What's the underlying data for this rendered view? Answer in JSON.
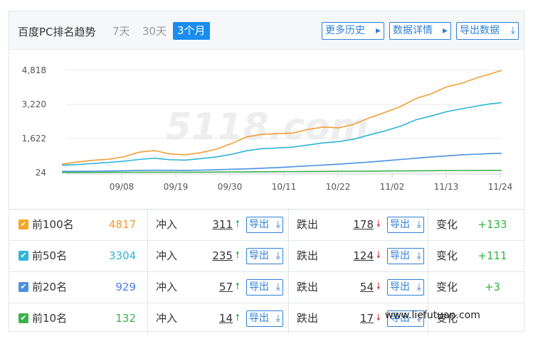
{
  "header": {
    "title": "百度PC排名趋势",
    "ranges": [
      "7天",
      "30天",
      "3个月"
    ],
    "buttons": {
      "history": "更多历史",
      "details": "数据详情",
      "export": "导出数据"
    }
  },
  "chart_data": {
    "type": "line",
    "x_ticks": [
      "09/08",
      "09/19",
      "09/30",
      "10/11",
      "10/22",
      "11/02",
      "11/13",
      "11/24"
    ],
    "y_ticks": [
      "4,818",
      "3,220",
      "1,622",
      "24"
    ],
    "ylim": [
      24,
      4818
    ],
    "grid": true,
    "x_positions": [
      0,
      0.035,
      0.07,
      0.105,
      0.14,
      0.175,
      0.21,
      0.245,
      0.28,
      0.315,
      0.35,
      0.385,
      0.42,
      0.455,
      0.49,
      0.525,
      0.56,
      0.595,
      0.63,
      0.665,
      0.7,
      0.735,
      0.77,
      0.805,
      0.84,
      0.875,
      0.91,
      0.945,
      0.975,
      1.0
    ],
    "series": [
      {
        "name": "前100名",
        "color": "#f39c34",
        "values": [
          420,
          520,
          600,
          650,
          760,
          980,
          1060,
          900,
          860,
          960,
          1120,
          1380,
          1700,
          1820,
          1850,
          1880,
          2050,
          2160,
          2120,
          2300,
          2600,
          2850,
          3120,
          3500,
          3720,
          4050,
          4220,
          4480,
          4650,
          4817
        ]
      },
      {
        "name": "前50名",
        "color": "#2fb5d6",
        "values": [
          370,
          400,
          450,
          500,
          560,
          640,
          700,
          630,
          610,
          680,
          760,
          880,
          1050,
          1150,
          1180,
          1220,
          1320,
          1420,
          1480,
          1600,
          1800,
          1980,
          2200,
          2500,
          2680,
          2880,
          3020,
          3150,
          3250,
          3304
        ]
      },
      {
        "name": "前20名",
        "color": "#4a90e2",
        "values": [
          80,
          85,
          90,
          100,
          110,
          130,
          140,
          135,
          130,
          140,
          160,
          180,
          200,
          230,
          260,
          300,
          340,
          380,
          420,
          470,
          520,
          580,
          640,
          700,
          760,
          810,
          860,
          890,
          915,
          929
        ]
      },
      {
        "name": "前10名",
        "color": "#3cb34a",
        "values": [
          30,
          32,
          35,
          38,
          40,
          45,
          48,
          46,
          45,
          48,
          52,
          56,
          60,
          66,
          70,
          74,
          78,
          82,
          86,
          90,
          95,
          100,
          105,
          110,
          115,
          120,
          124,
          128,
          130,
          132
        ]
      }
    ]
  },
  "rows": [
    {
      "name": "前100名",
      "count": "4817",
      "count_color": "#f39c34",
      "check_color": "#f5a623",
      "in_label": "冲入",
      "in_value": "311",
      "out_label": "跌出",
      "out_value": "178",
      "export": "导出",
      "change_label": "变化",
      "change_value": "+133"
    },
    {
      "name": "前50名",
      "count": "3304",
      "count_color": "#2fb5d6",
      "check_color": "#30b6d8",
      "in_label": "冲入",
      "in_value": "235",
      "out_label": "跌出",
      "out_value": "124",
      "export": "导出",
      "change_label": "变化",
      "change_value": "+111"
    },
    {
      "name": "前20名",
      "count": "929",
      "count_color": "#4a7fe0",
      "check_color": "#4a90e2",
      "in_label": "冲入",
      "in_value": "57",
      "out_label": "跌出",
      "out_value": "54",
      "export": "导出",
      "change_label": "变化",
      "change_value": "+3"
    },
    {
      "name": "前10名",
      "count": "132",
      "count_color": "#3cb34a",
      "check_color": "#3cb34a",
      "in_label": "冲入",
      "in_value": "14",
      "out_label": "跌出",
      "out_value": "17",
      "export": "导出",
      "change_label": "变化",
      "change_value": ""
    }
  ],
  "watermark": "www.liefutuan.com",
  "chart_watermark": "5118.com"
}
